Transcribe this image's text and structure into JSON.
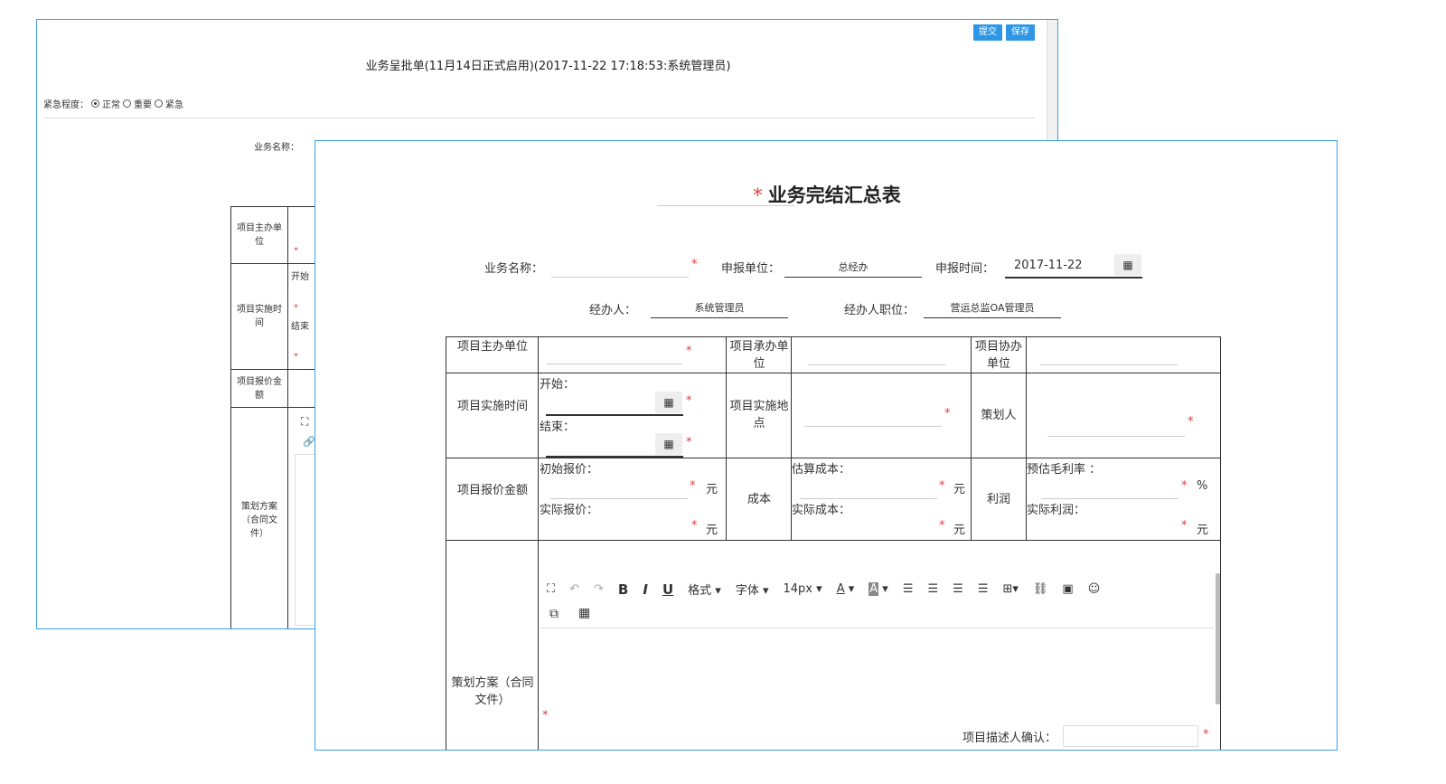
{
  "back": {
    "submit_label": "提交",
    "save_label": "保存",
    "title": "业务呈批单(11月14日正式启用)(2017-11-22 17:18:53:系统管理员)",
    "urgency_label": "紧急程度：",
    "urgency_options": [
      "正常",
      "重要",
      "紧急"
    ],
    "urgency_selected": "正常",
    "business_name_label": "业务名称：",
    "rows": {
      "main_unit": "项目主办单位",
      "impl_time": "项目实施时间",
      "start": "开始",
      "end": "结束",
      "quote": "项目报价金额",
      "plan": "策划方案（合同文件）"
    }
  },
  "front": {
    "title": "业务完结汇总表",
    "required_mark": "*",
    "business_name_label": "业务名称：",
    "report_unit_label": "申报单位：",
    "report_unit_value": "总经办",
    "report_time_label": "申报时间：",
    "report_time_value": "2017-11-22",
    "handler_label": "经办人：",
    "handler_value": "系统管理员",
    "handler_position_label": "经办人职位：",
    "handler_position_value": "营运总监OA管理员",
    "table": {
      "main_unit": "项目主办单位",
      "undertake_unit": "项目承办单位",
      "assist_unit": "项目协办单位",
      "impl_time": "项目实施时间",
      "start_label": "开始：",
      "end_label": "结束：",
      "impl_place": "项目实施地点",
      "planner": "策划人",
      "quote_amount": "项目报价金额",
      "initial_quote": "初始报价：",
      "actual_quote": "实际报价：",
      "cost": "成本",
      "est_cost": "估算成本：",
      "actual_cost": "实际成本：",
      "profit": "利润",
      "est_margin": "预估毛利率 ：",
      "actual_profit": "实际利润：",
      "unit_yuan": "元",
      "unit_percent": "%",
      "plan": "策划方案（合同文件）",
      "confirm_label": "项目描述人确认："
    },
    "toolbar": {
      "format": "格式",
      "font": "字体",
      "size": "14px",
      "font_color": "A",
      "bg_color": "A",
      "bold": "B",
      "italic": "I",
      "underline": "U"
    }
  }
}
